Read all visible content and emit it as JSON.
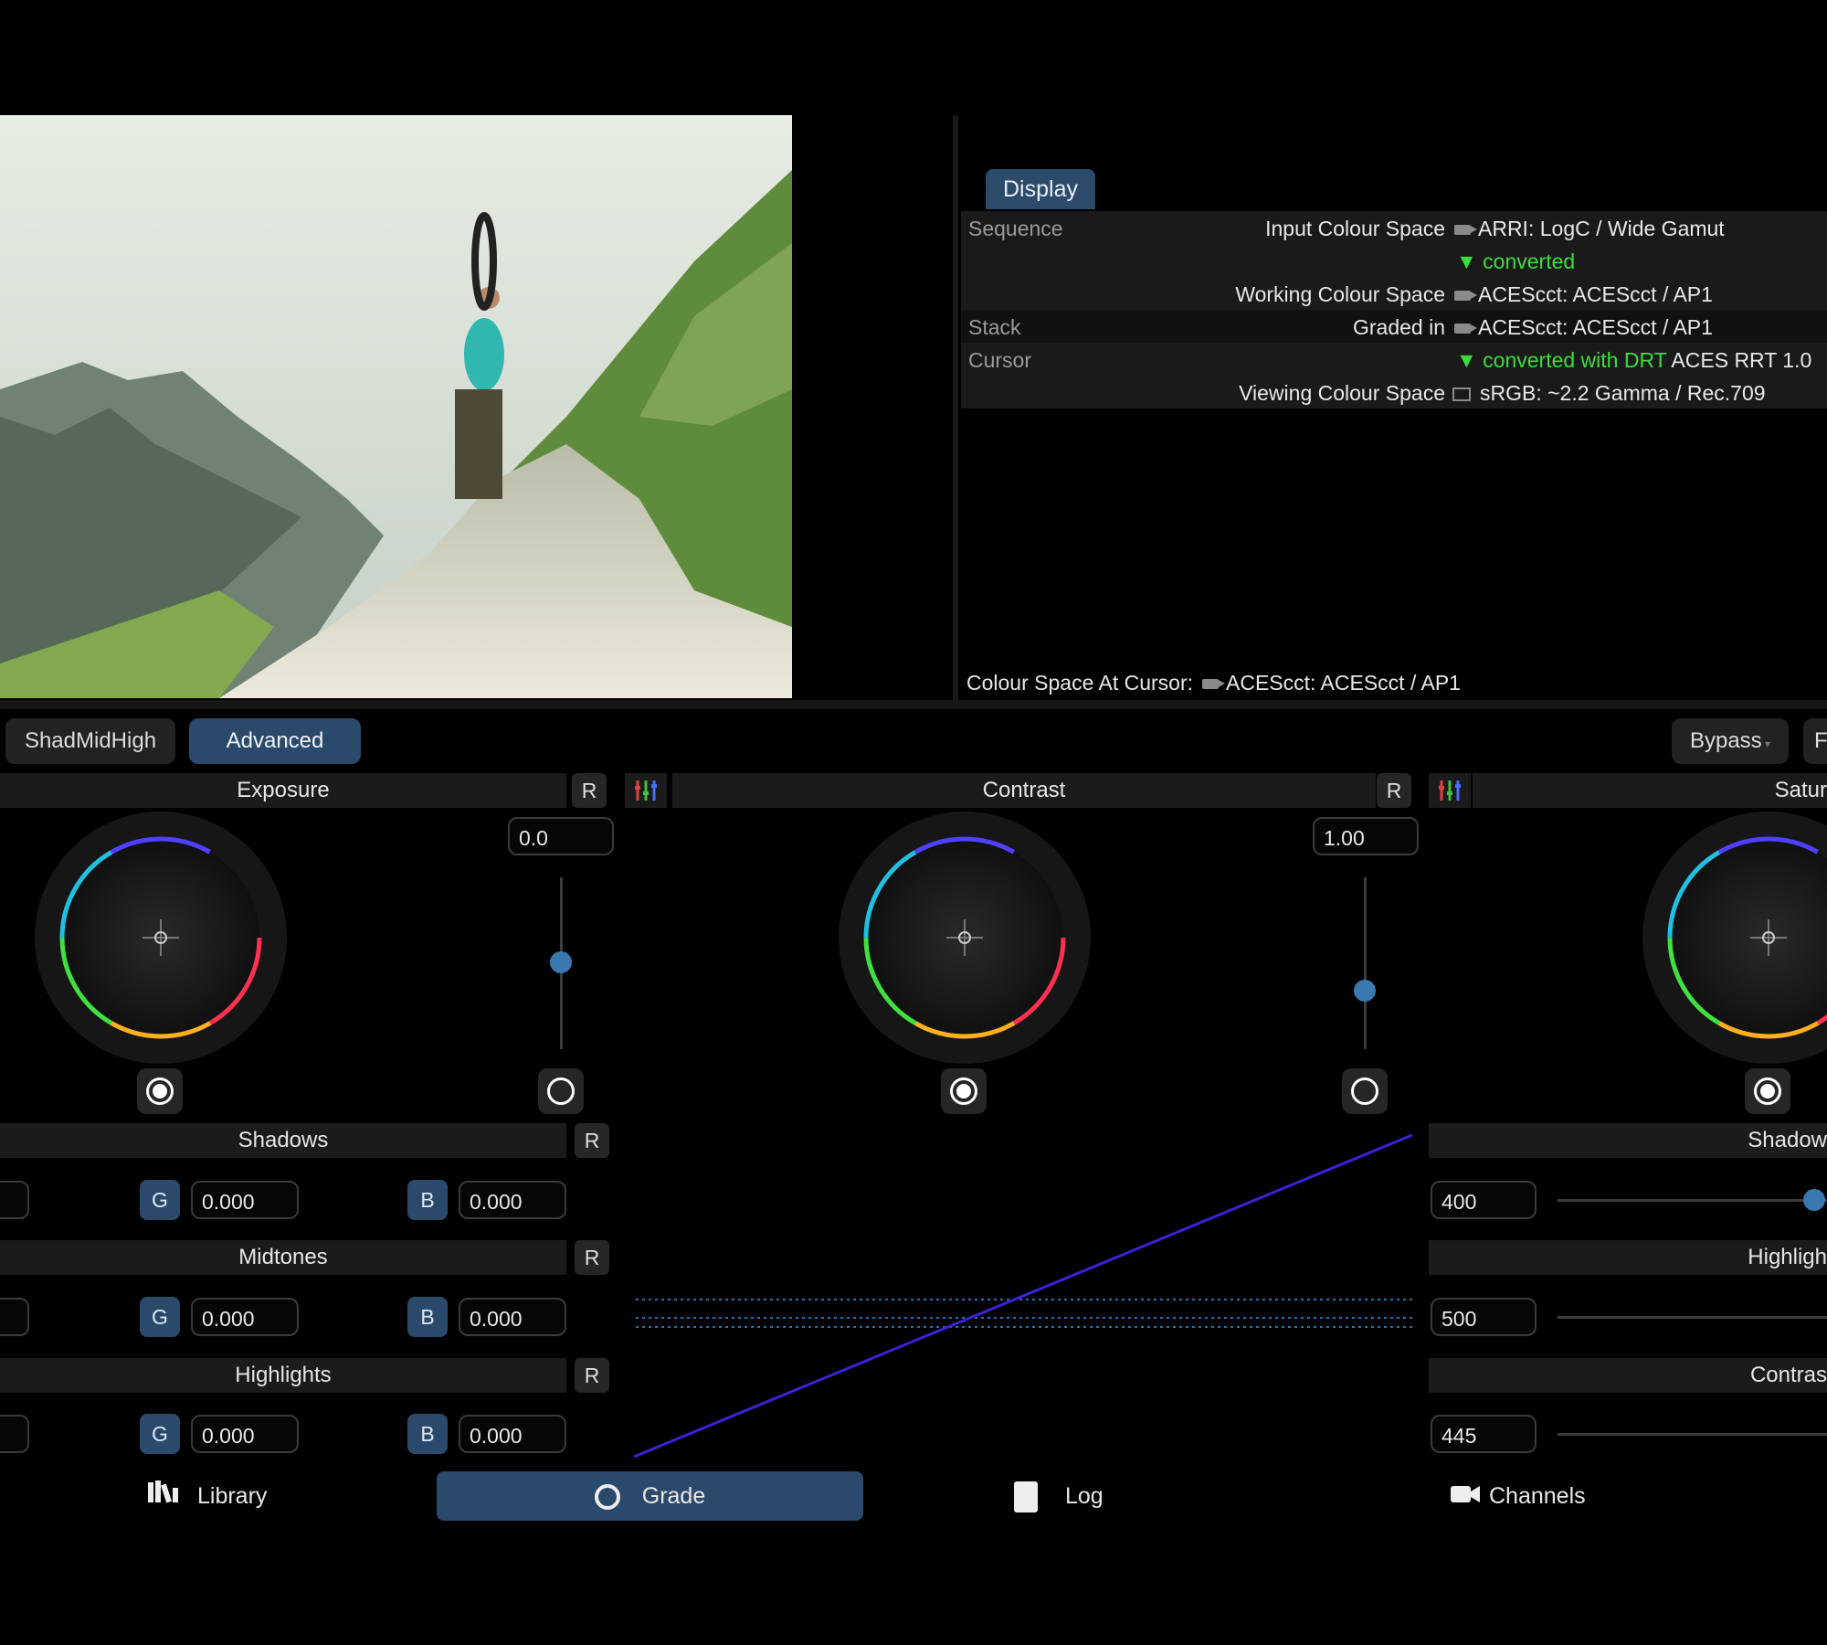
{
  "info_panel": {
    "tab": "Display",
    "rows": [
      {
        "section": "Sequence",
        "label": "Input Colour Space",
        "value": "ARRI: LogC / Wide Gamut"
      },
      {
        "section": "",
        "label": "",
        "converted": "converted"
      },
      {
        "section": "",
        "label": "Working Colour Space",
        "value": "ACEScct: ACEScct / AP1"
      },
      {
        "section": "Stack",
        "label": "Graded in",
        "value": "ACEScct: ACEScct / AP1"
      },
      {
        "section": "Cursor",
        "converted_with": "converted with DRT",
        "value": "ACES RRT 1.0"
      },
      {
        "section": "",
        "label": "Viewing Colour Space",
        "value": "sRGB: ~2.2 Gamma / Rec.709"
      }
    ],
    "at_cursor_label": "Colour Space At Cursor:",
    "at_cursor_value": "ACEScct: ACEScct / AP1"
  },
  "mode_tabs": {
    "shadmidhigh": "ShadMidHigh",
    "advanced": "Advanced",
    "bypass": "Bypass",
    "partial": "F"
  },
  "wheels": {
    "exposure": {
      "title": "Exposure",
      "reset": "R",
      "value": "0.0",
      "slider_level": 0.5
    },
    "contrast": {
      "title": "Contrast",
      "reset": "R",
      "value": "1.00",
      "slider_level": 0.33
    },
    "saturation": {
      "title": "Satur"
    }
  },
  "tone": {
    "shadows": {
      "title": "Shadows",
      "reset": "R",
      "g": "0.000",
      "b": "0.000"
    },
    "midtones": {
      "title": "Midtones",
      "reset": "R",
      "g": "0.000",
      "b": "0.000"
    },
    "highlights": {
      "title": "Highlights",
      "reset": "R",
      "g": "0.000",
      "b": "0.000"
    },
    "channel_g": "G",
    "channel_b": "B"
  },
  "pivots": {
    "shadow": {
      "title": "Shadow",
      "value": "400"
    },
    "highlight": {
      "title": "Highligh",
      "value": "500"
    },
    "contrast": {
      "title": "Contras",
      "value": "445"
    }
  },
  "bottom_nav": {
    "library": "Library",
    "grade": "Grade",
    "log": "Log",
    "channels": "Channels"
  }
}
